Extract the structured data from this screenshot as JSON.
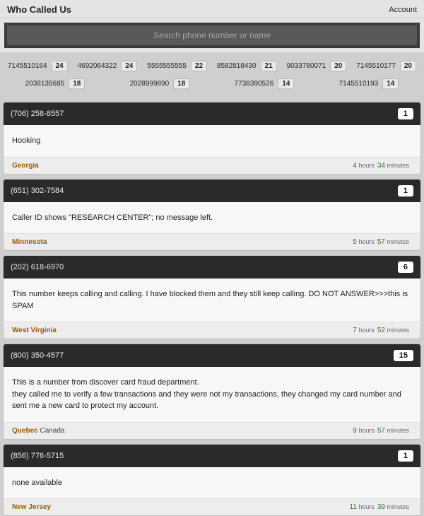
{
  "header": {
    "title": "Who Called Us",
    "account": "Account"
  },
  "search": {
    "placeholder": "Search phone number or name"
  },
  "top_numbers": [
    {
      "number": "7145510164",
      "count": "24"
    },
    {
      "number": "4692064322",
      "count": "24"
    },
    {
      "number": "5555555555",
      "count": "22"
    },
    {
      "number": "8582818430",
      "count": "21"
    },
    {
      "number": "9033780071",
      "count": "20"
    },
    {
      "number": "7145510177",
      "count": "20"
    },
    {
      "number": "2038135685",
      "count": "18"
    },
    {
      "number": "2028999890",
      "count": "18"
    },
    {
      "number": "7738390526",
      "count": "14"
    },
    {
      "number": "7145510193",
      "count": "14"
    }
  ],
  "reports": [
    {
      "phone": "(706) 258-8557",
      "badge": "1",
      "body": "Hooking",
      "region": "Georgia",
      "country": "",
      "time": [
        {
          "n": "4",
          "u": "hours"
        },
        {
          "n": "34",
          "u": "minutes"
        }
      ]
    },
    {
      "phone": "(651) 302-7584",
      "badge": "1",
      "body": "Caller ID shows \"RESEARCH CENTER\"; no message left.",
      "region": "Minnesota",
      "country": "",
      "time": [
        {
          "n": "5",
          "u": "hours"
        },
        {
          "n": "57",
          "u": "minutes"
        }
      ]
    },
    {
      "phone": "(202) 618-6970",
      "badge": "6",
      "body": "This number keeps calling and calling. I have blocked them and they still keep calling. DO NOT ANSWER>>>this is SPAM",
      "region": "West Virginia",
      "country": "",
      "time": [
        {
          "n": "7",
          "u": "hours"
        },
        {
          "n": "52",
          "u": "minutes"
        }
      ]
    },
    {
      "phone": "(800) 350-4577",
      "badge": "15",
      "body": "This is a number from discover card fraud department.\nthey called me to verify a few transactions and they were not my transactions, they changed my card number and sent me a new card to protect my account.",
      "region": "Quebec",
      "country": "Canada",
      "time": [
        {
          "n": "9",
          "u": "hours"
        },
        {
          "n": "57",
          "u": "minutes"
        }
      ]
    },
    {
      "phone": "(856) 776-5715",
      "badge": "1",
      "body": "none available",
      "region": "New Jersey",
      "country": "",
      "time": [
        {
          "n": "11",
          "u": "hours"
        },
        {
          "n": "39",
          "u": "minutes"
        }
      ]
    }
  ]
}
